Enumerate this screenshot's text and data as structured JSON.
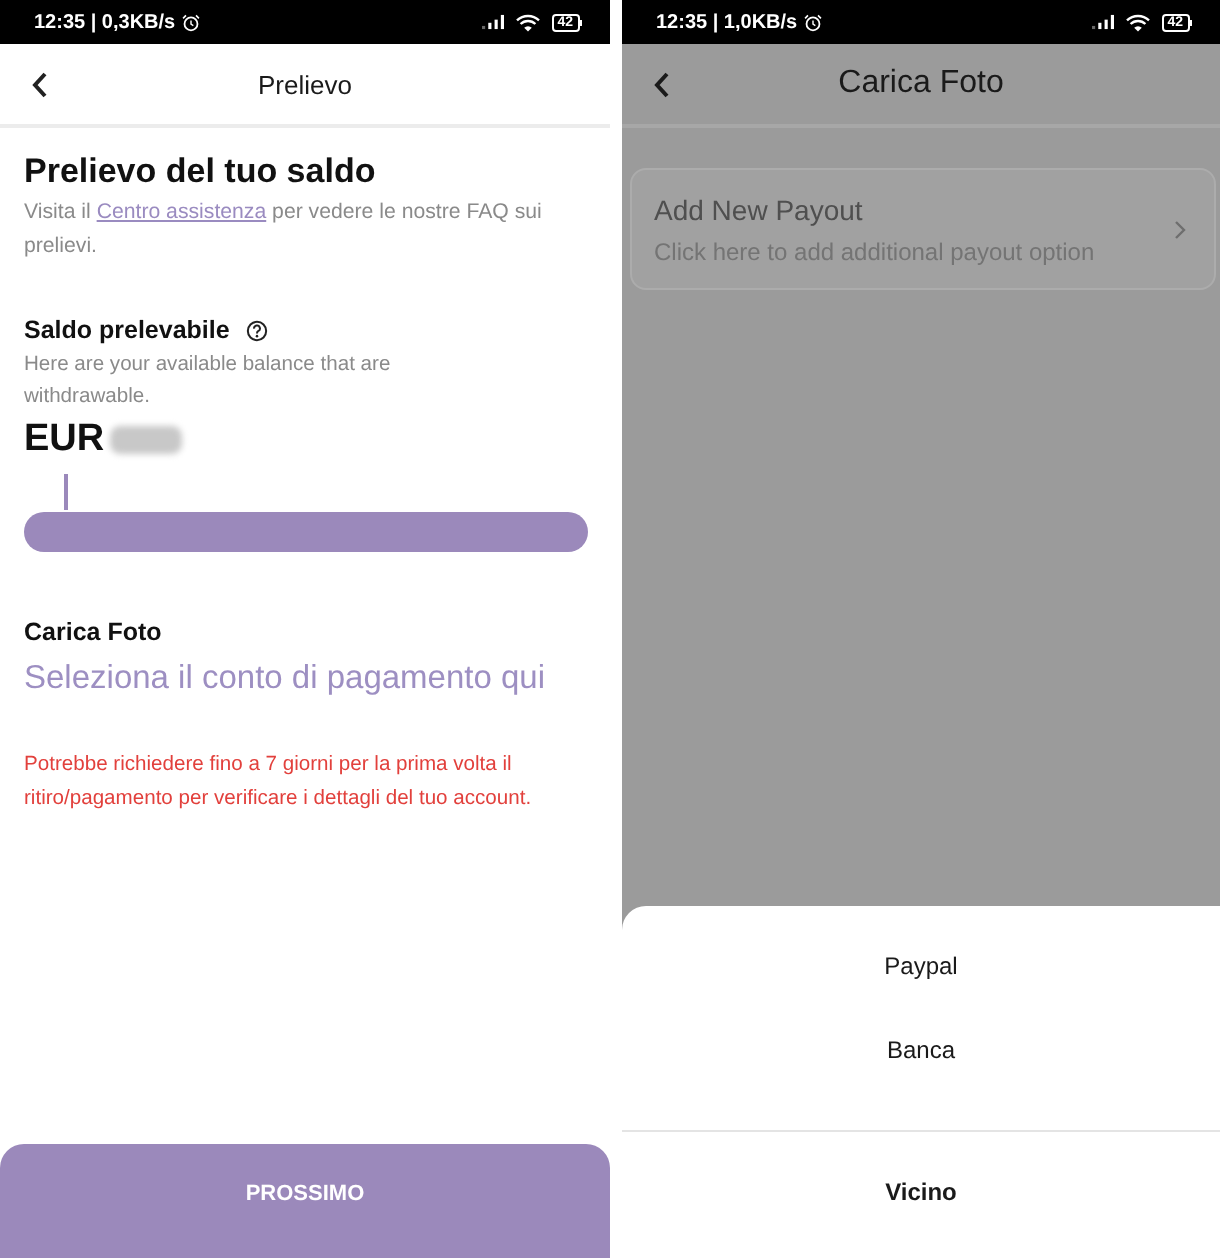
{
  "withdraw_screen": {
    "status_bar": {
      "text": "12:35 | 0,3KB/s",
      "battery": "42"
    },
    "header": {
      "title": "Prelievo"
    },
    "heading": "Prelievo del tuo saldo",
    "intro": {
      "before": "Visita il",
      "link": "Centro assistenza",
      "after": "per vedere le nostre FAQ sui prelievi."
    },
    "balance": {
      "label": "Saldo prelevabile",
      "hint": "Here are your available balance that are withdrawable.",
      "currency": "EUR"
    },
    "upload": {
      "label": "Carica Foto",
      "select_link": "Seleziona il conto di pagamento qui"
    },
    "notice": "Potrebbe richiedere fino a 7 giorni per la prima volta il ritiro/pagamento per verificare i dettagli del tuo account.",
    "next_button": "PROSSIMO"
  },
  "payout_screen": {
    "status_bar": {
      "text": "12:35 | 1,0KB/s",
      "battery": "42"
    },
    "header": {
      "title": "Carica Foto"
    },
    "card": {
      "title": "Add New Payout",
      "subtitle": "Click here to add additional payout option"
    },
    "sheet": {
      "options": [
        {
          "label": "Paypal",
          "kind": "option"
        },
        {
          "label": "Banca",
          "kind": "option"
        },
        {
          "label": "Vicino",
          "kind": "cancel"
        }
      ]
    }
  }
}
